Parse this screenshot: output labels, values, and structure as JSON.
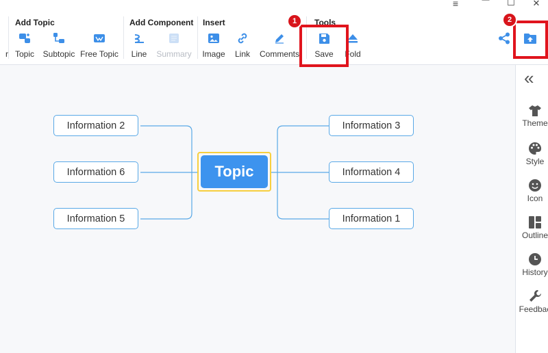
{
  "toolbar": {
    "cut_label": "r",
    "groups": {
      "add_topic": "Add Topic",
      "add_component": "Add Component",
      "insert": "Insert",
      "tools": "Tools"
    },
    "items": {
      "topic": "Topic",
      "subtopic": "Subtopic",
      "free_topic": "Free Topic",
      "line": "Line",
      "summary": "Summary",
      "image": "Image",
      "link": "Link",
      "comments": "Comments",
      "save": "Save",
      "fold": "Fold"
    },
    "accent_color": "#3d8fe8"
  },
  "window_controls": {
    "menu": "≡",
    "minimize": "—",
    "maximize": "☐",
    "close": "✕"
  },
  "annotations": {
    "step1": "1",
    "step2": "2",
    "highlight_color": "#e0141d"
  },
  "mindmap": {
    "central": "Topic",
    "left": [
      "Information 2",
      "Information 6",
      "Information 5"
    ],
    "right": [
      "Information 3",
      "Information 4",
      "Information 1"
    ]
  },
  "sidebar": {
    "collapse_icon": "«",
    "items": [
      "Theme",
      "Style",
      "Icon",
      "Outline",
      "History",
      "Feedbac"
    ]
  }
}
